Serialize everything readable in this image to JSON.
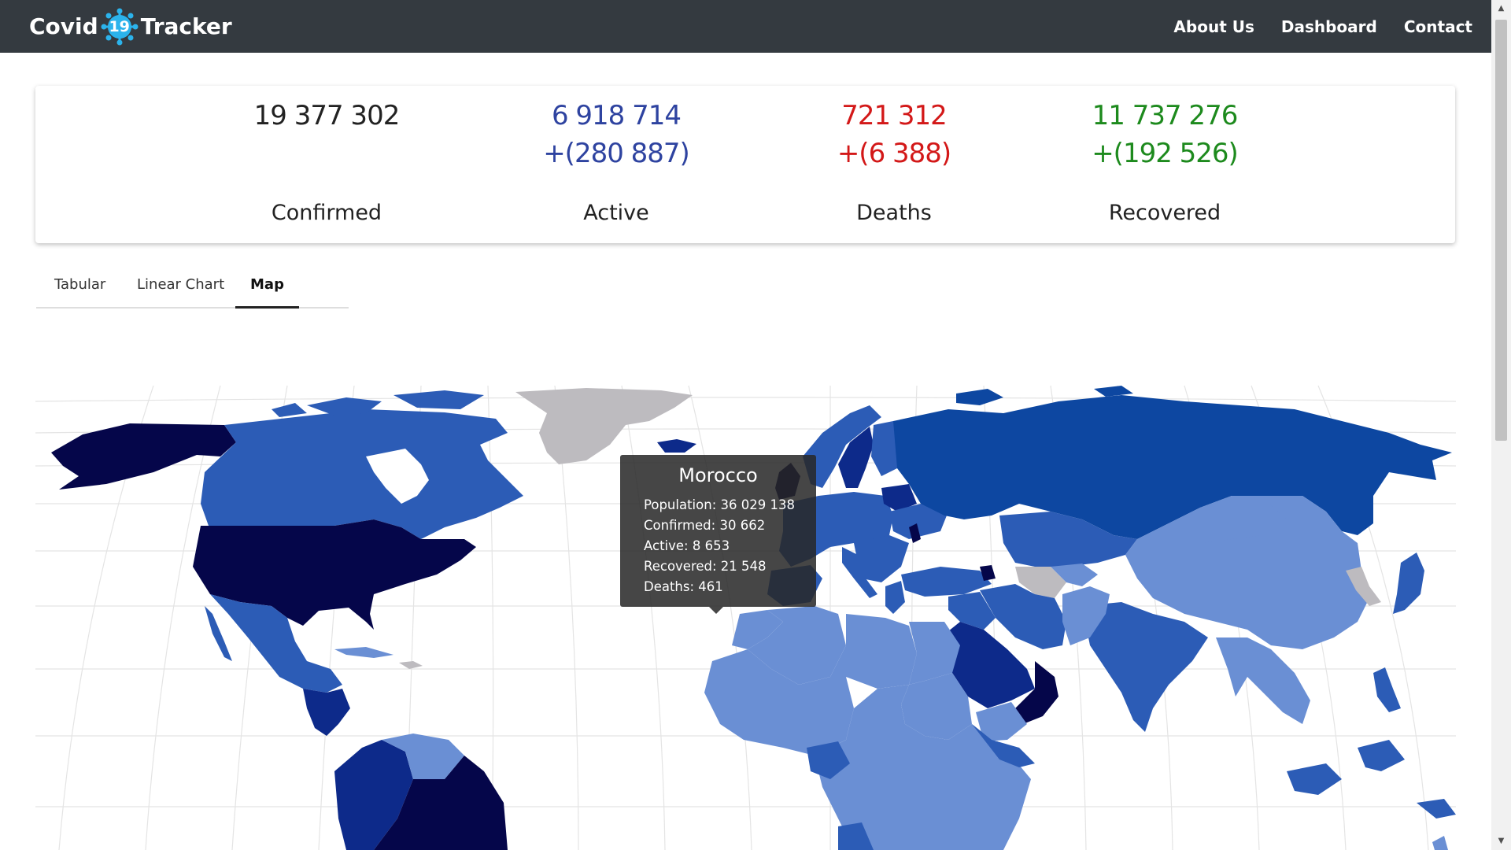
{
  "brand": {
    "word1": "Covid",
    "badge": "19",
    "word2": "Tracker"
  },
  "nav": {
    "about": "About Us",
    "dashboard": "Dashboard",
    "contact": "Contact"
  },
  "stats": {
    "confirmed": {
      "total": "19 377 302",
      "delta": "",
      "label": "Confirmed"
    },
    "active": {
      "total": "6 918 714",
      "delta": "+(280 887)",
      "label": "Active"
    },
    "deaths": {
      "total": "721 312",
      "delta": "+(6 388)",
      "label": "Deaths"
    },
    "recovered": {
      "total": "11 737 276",
      "delta": "+(192 526)",
      "label": "Recovered"
    }
  },
  "tabs": [
    {
      "label": "Tabular",
      "active": false
    },
    {
      "label": "Linear Chart",
      "active": false
    },
    {
      "label": "Map",
      "active": true
    }
  ],
  "tooltip": {
    "country": "Morocco",
    "population": "Population: 36 029 138",
    "confirmed": "Confirmed: 30 662",
    "active": "Active: 8 653",
    "recovered": "Recovered: 21 548",
    "deaths": "Deaths: 461"
  },
  "colors": {
    "navbar": "#343a40",
    "active": "#2e43a0",
    "deaths": "#d31818",
    "recovered": "#1d8a1d",
    "map_darkest": "#05064a",
    "map_dark": "#0d2a8a",
    "map_mid": "#2c5cb6",
    "map_light": "#6a8fd4",
    "map_nodata": "#bdbbbf"
  }
}
